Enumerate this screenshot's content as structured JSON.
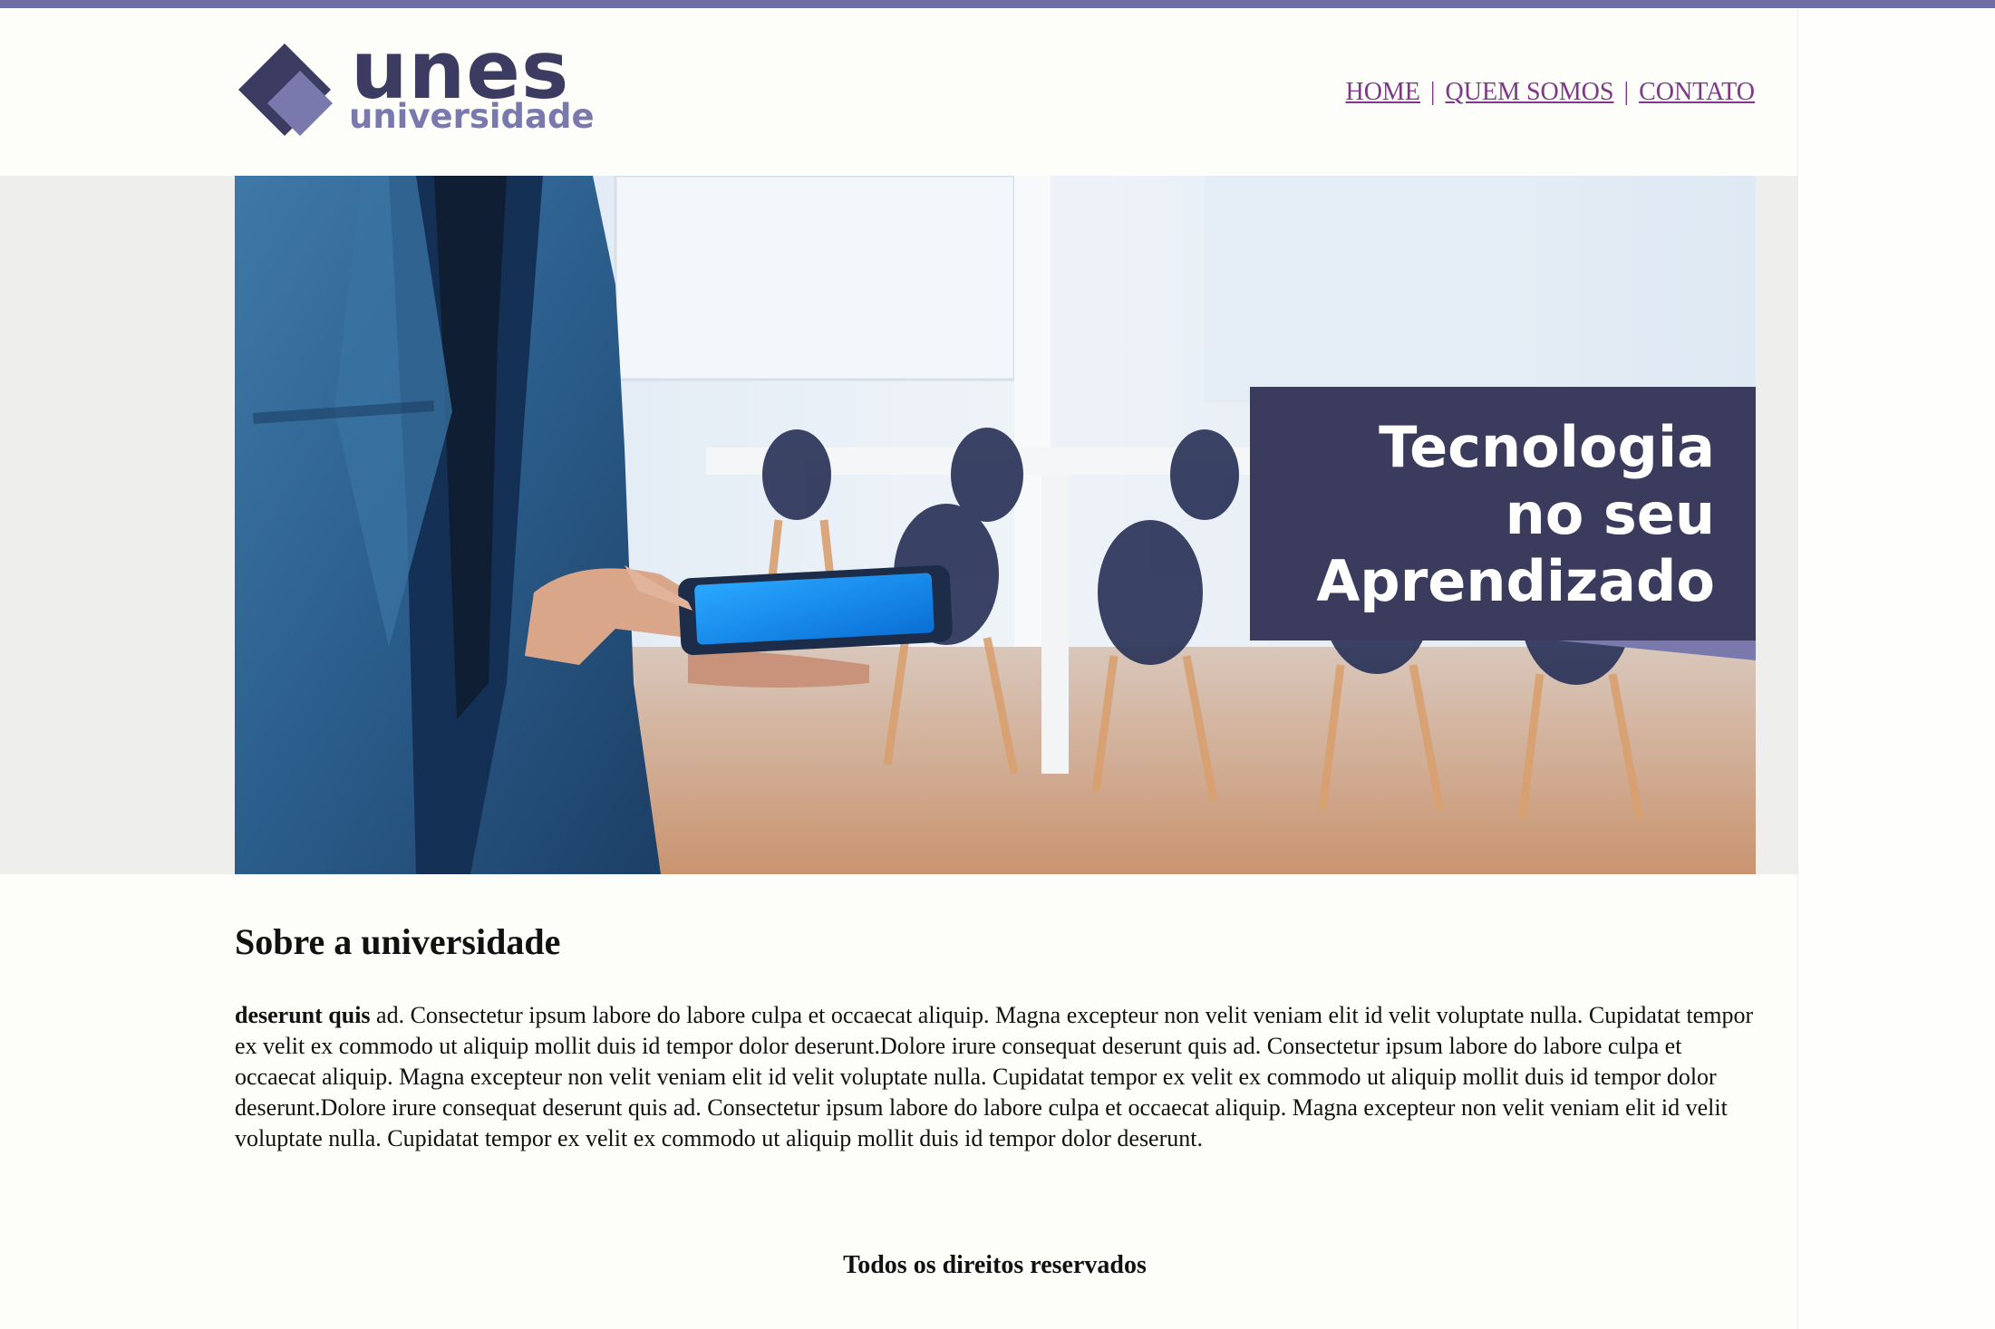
{
  "logo": {
    "word": "unes",
    "subtitle": "universidade"
  },
  "nav": {
    "items": [
      "HOME",
      "QUEM SOMOS",
      "CONTATO"
    ],
    "separator": "|"
  },
  "banner": {
    "line1": "Tecnologia",
    "line2": "no seu",
    "line3": "Aprendizado"
  },
  "about": {
    "title": "Sobre a universidade",
    "lead_bold": "deserunt quis",
    "body": " ad. Consectetur ipsum labore do labore culpa et occaecat aliquip. Magna excepteur non velit veniam elit id velit voluptate nulla. Cupidatat tempor ex velit ex commodo ut aliquip mollit duis id tempor dolor deserunt.Dolore irure consequat deserunt quis ad. Consectetur ipsum labore do labore culpa et occaecat aliquip. Magna excepteur non velit veniam elit id velit voluptate nulla. Cupidatat tempor ex velit ex commodo ut aliquip mollit duis id tempor dolor deserunt.Dolore irure consequat deserunt quis ad. Consectetur ipsum labore do labore culpa et occaecat aliquip. Magna excepteur non velit veniam elit id velit voluptate nulla. Cupidatat tempor ex velit ex commodo ut aliquip mollit duis id tempor dolor deserunt."
  },
  "footer": {
    "text": "Todos os direitos reservados"
  },
  "colors": {
    "brand_dark": "#3c3c63",
    "brand_light": "#7a79ad",
    "top_strip": "#6f6fa6",
    "link": "#7c3a86",
    "banner_box": "#3b3b5e"
  }
}
